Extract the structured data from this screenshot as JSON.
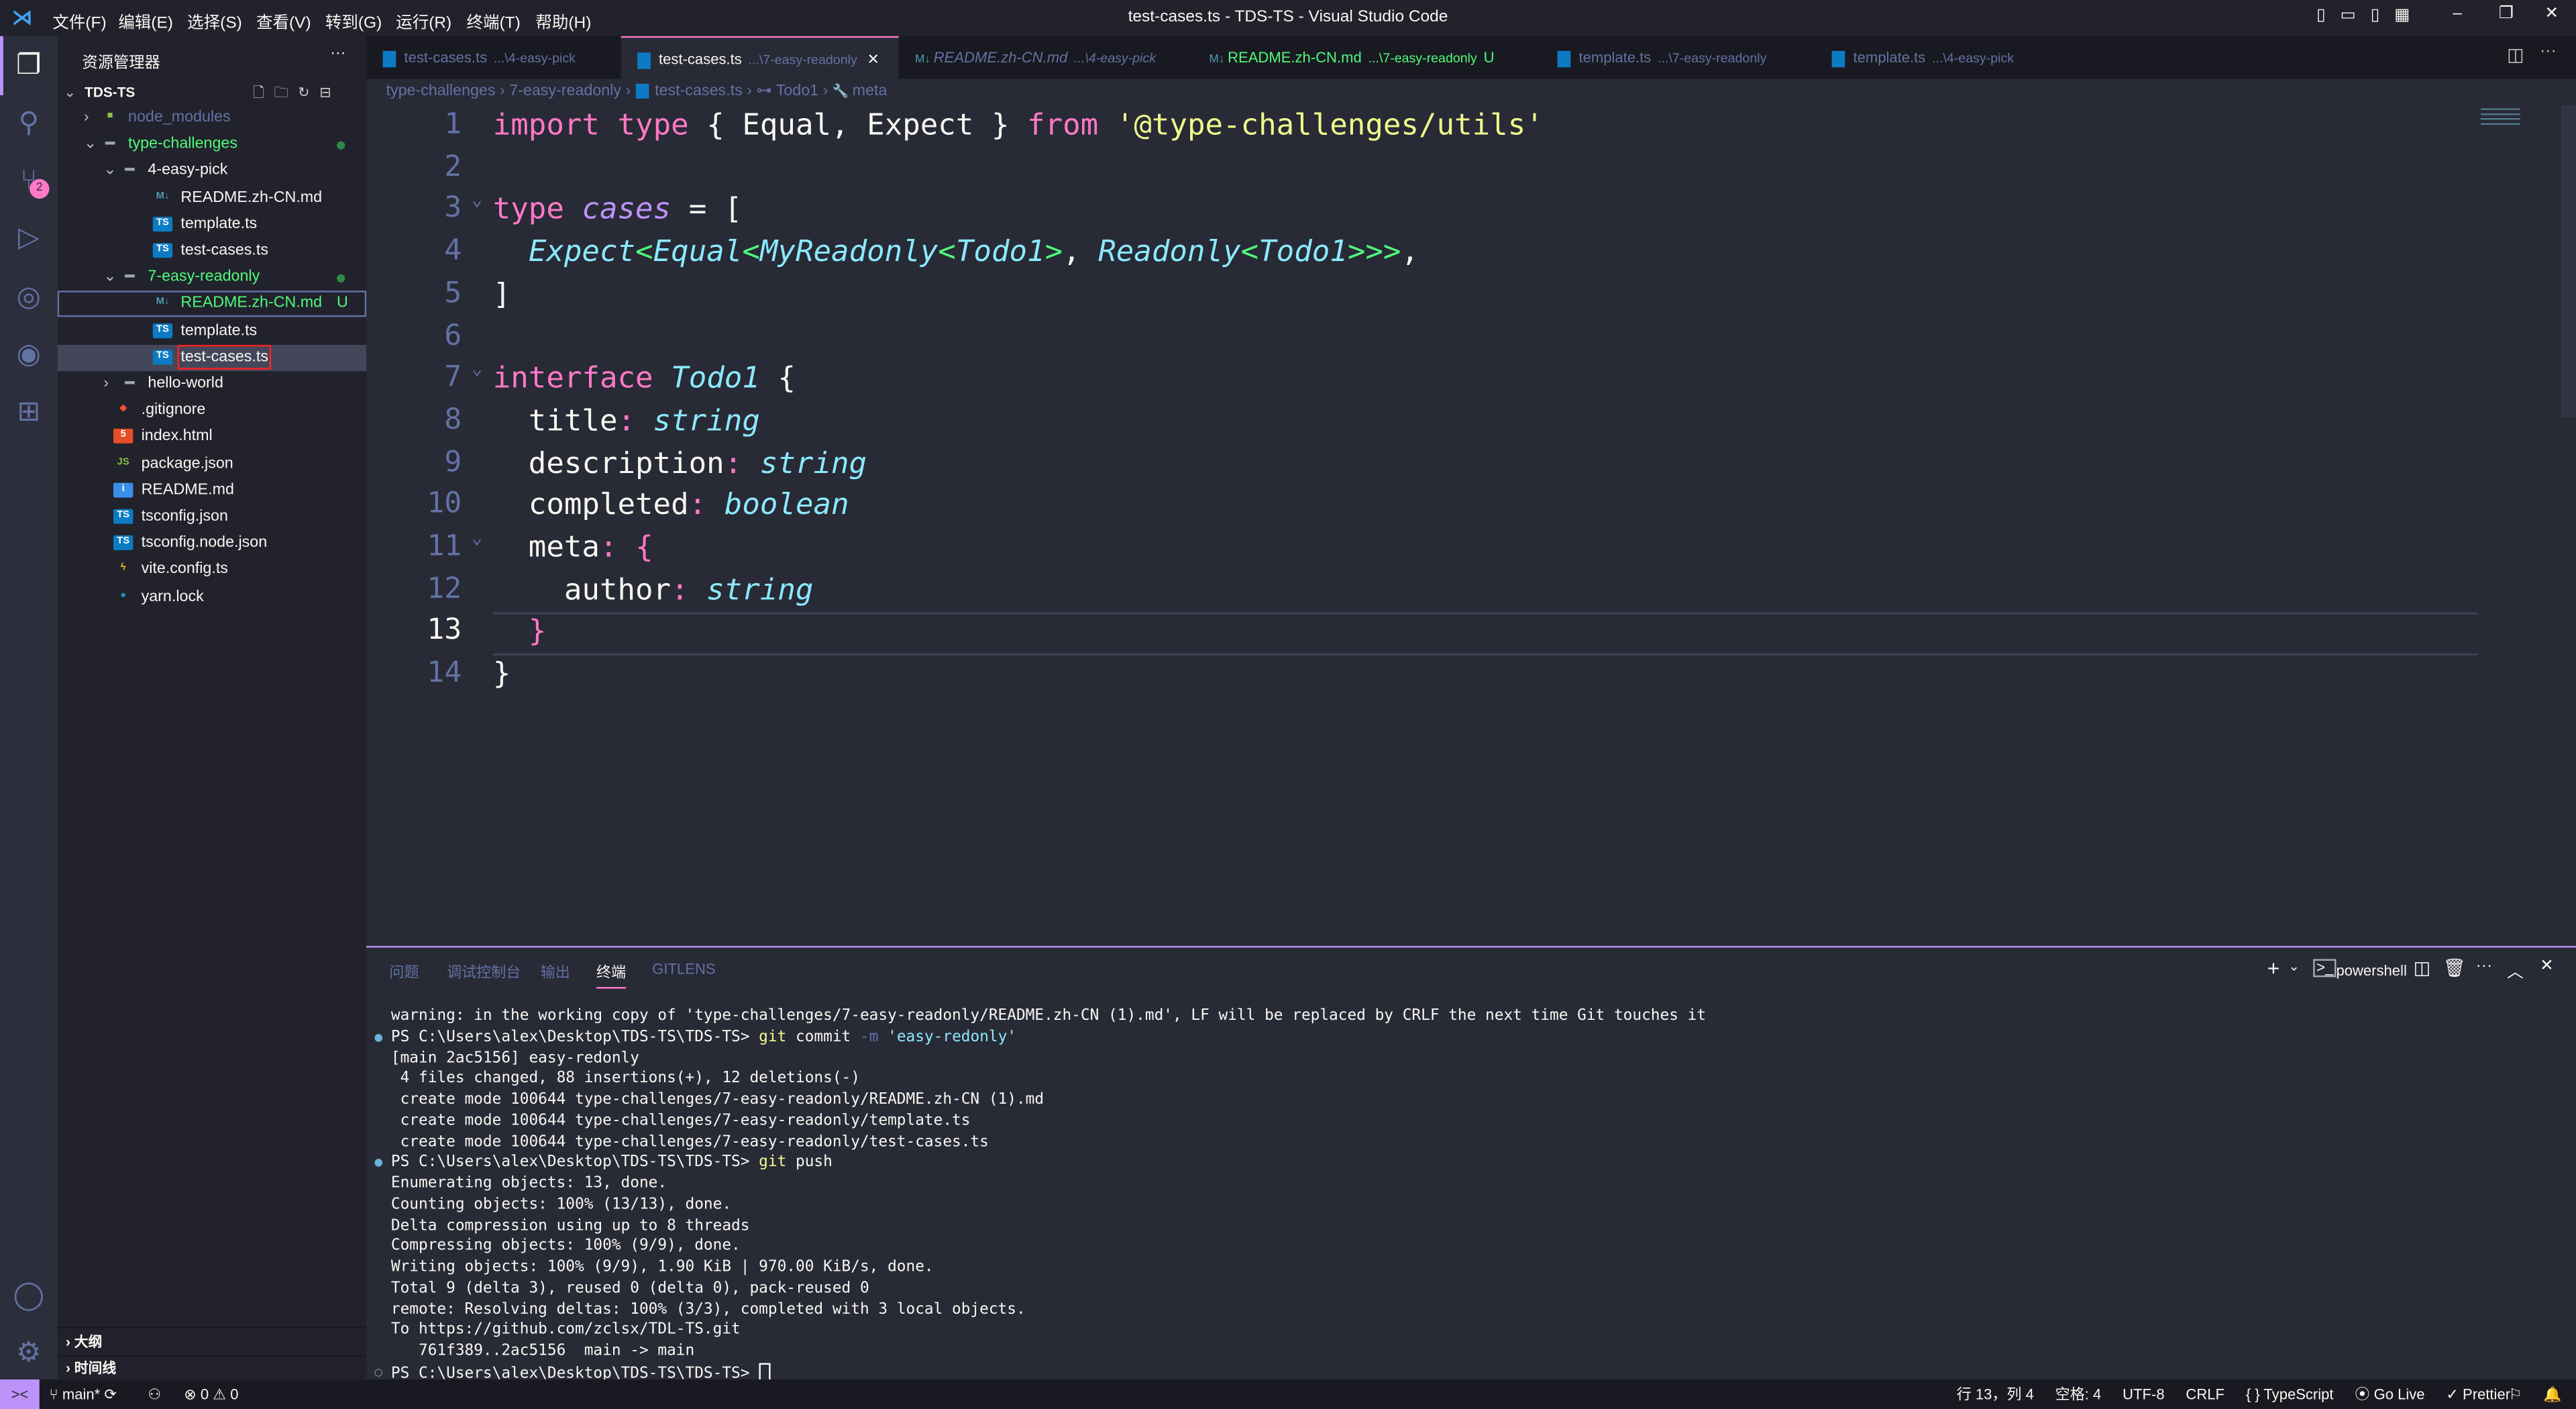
{
  "titlebar": {
    "title": "test-cases.ts - TDS-TS - Visual Studio Code",
    "menus": [
      "文件(F)",
      "编辑(E)",
      "选择(S)",
      "查看(V)",
      "转到(G)",
      "运行(R)",
      "终端(T)",
      "帮助(H)"
    ]
  },
  "activity": {
    "items": [
      "explorer-icon",
      "search-icon",
      "source-control-icon",
      "run-debug-icon",
      "remote-explorer-icon",
      "gitlens-icon",
      "extensions-icon"
    ],
    "scm_badge": "2",
    "bottom": [
      "account-icon",
      "settings-gear-icon"
    ]
  },
  "sidebar": {
    "header": "资源管理器",
    "more": "···",
    "root": "TDS-TS",
    "items": [
      {
        "label": "node_modules",
        "depth": 1,
        "kind": "folder-closed",
        "color": "#6272a4",
        "icon": "node-folder"
      },
      {
        "label": "type-challenges",
        "depth": 1,
        "kind": "folder-open",
        "color": "#50fa7b",
        "icon": "folder",
        "dot": true
      },
      {
        "label": "4-easy-pick",
        "depth": 2,
        "kind": "folder-open",
        "color": "#f8f8f2",
        "icon": "folder"
      },
      {
        "label": "README.zh-CN.md",
        "depth": 3,
        "kind": "file",
        "color": "#f8f8f2",
        "icon": "markdown"
      },
      {
        "label": "template.ts",
        "depth": 3,
        "kind": "file",
        "color": "#f8f8f2",
        "icon": "ts"
      },
      {
        "label": "test-cases.ts",
        "depth": 3,
        "kind": "file",
        "color": "#f8f8f2",
        "icon": "ts"
      },
      {
        "label": "7-easy-readonly",
        "depth": 2,
        "kind": "folder-open",
        "color": "#50fa7b",
        "icon": "folder",
        "dot": true
      },
      {
        "label": "README.zh-CN.md",
        "depth": 3,
        "kind": "file",
        "color": "#50fa7b",
        "icon": "markdown",
        "badge": "U",
        "focused": true
      },
      {
        "label": "template.ts",
        "depth": 3,
        "kind": "file",
        "color": "#f8f8f2",
        "icon": "ts"
      },
      {
        "label": "test-cases.ts",
        "depth": 3,
        "kind": "file",
        "color": "#f8f8f2",
        "icon": "ts",
        "selected": true
      },
      {
        "label": "hello-world",
        "depth": 2,
        "kind": "folder-closed",
        "color": "#f8f8f2",
        "icon": "folder"
      },
      {
        "label": ".gitignore",
        "depth": 1,
        "kind": "file",
        "color": "#f8f8f2",
        "icon": "git"
      },
      {
        "label": "index.html",
        "depth": 1,
        "kind": "file",
        "color": "#f8f8f2",
        "icon": "html"
      },
      {
        "label": "package.json",
        "depth": 1,
        "kind": "file",
        "color": "#f8f8f2",
        "icon": "nodejs"
      },
      {
        "label": "README.md",
        "depth": 1,
        "kind": "file",
        "color": "#f8f8f2",
        "icon": "info"
      },
      {
        "label": "tsconfig.json",
        "depth": 1,
        "kind": "file",
        "color": "#f8f8f2",
        "icon": "tsconfig"
      },
      {
        "label": "tsconfig.node.json",
        "depth": 1,
        "kind": "file",
        "color": "#f8f8f2",
        "icon": "tsconfig"
      },
      {
        "label": "vite.config.ts",
        "depth": 1,
        "kind": "file",
        "color": "#f8f8f2",
        "icon": "vite"
      },
      {
        "label": "yarn.lock",
        "depth": 1,
        "kind": "file",
        "color": "#f8f8f2",
        "icon": "yarn"
      }
    ],
    "outline": "大纲",
    "timeline": "时间线"
  },
  "tabs": [
    {
      "name": "test-cases.ts",
      "path": "...\\4-easy-pick",
      "icon": "ts"
    },
    {
      "name": "test-cases.ts",
      "path": "...\\7-easy-readonly",
      "icon": "ts",
      "active": true
    },
    {
      "name": "README.zh-CN.md",
      "path": "...\\4-easy-pick",
      "icon": "markdown",
      "italic": true
    },
    {
      "name": "README.zh-CN.md",
      "path": "...\\7-easy-readonly",
      "icon": "markdown",
      "status": "U",
      "green": true
    },
    {
      "name": "template.ts",
      "path": "...\\7-easy-readonly",
      "icon": "ts"
    },
    {
      "name": "template.ts",
      "path": "...\\4-easy-pick",
      "icon": "ts"
    }
  ],
  "breadcrumb": [
    "type-challenges",
    "7-easy-readonly",
    "test-cases.ts",
    "Todo1",
    "meta"
  ],
  "editor": {
    "current_line": 13,
    "lines": [
      [
        [
          "import",
          "k"
        ],
        [
          " type ",
          "k"
        ],
        [
          "{ ",
          "p"
        ],
        [
          "Equal",
          "p"
        ],
        [
          ", ",
          "p"
        ],
        [
          "Expect",
          "p"
        ],
        [
          " } ",
          "p"
        ],
        [
          "from",
          "k"
        ],
        [
          " ",
          "p"
        ],
        [
          "'@type-challenges/utils'",
          "s"
        ]
      ],
      [],
      [
        [
          "type",
          "k"
        ],
        [
          " ",
          "p"
        ],
        [
          "cases",
          "pu"
        ],
        [
          " = [",
          "p"
        ]
      ],
      [
        [
          "  ",
          "p"
        ],
        [
          "Expect",
          "t"
        ],
        [
          "<",
          "g"
        ],
        [
          "Equal",
          "t"
        ],
        [
          "<",
          "g"
        ],
        [
          "MyReadonly",
          "t"
        ],
        [
          "<",
          "g"
        ],
        [
          "Todo1",
          "t"
        ],
        [
          ">",
          "g"
        ],
        [
          ", ",
          "p"
        ],
        [
          "Readonly",
          "t"
        ],
        [
          "<",
          "g"
        ],
        [
          "Todo1",
          "t"
        ],
        [
          ">>>",
          "g"
        ],
        [
          ",",
          "p"
        ]
      ],
      [
        [
          "]",
          "p"
        ]
      ],
      [],
      [
        [
          "interface",
          "k"
        ],
        [
          " ",
          "p"
        ],
        [
          "Todo1",
          "t"
        ],
        [
          " {",
          "p"
        ]
      ],
      [
        [
          "  title",
          "p"
        ],
        [
          ": ",
          "k"
        ],
        [
          "string",
          "t"
        ]
      ],
      [
        [
          "  description",
          "p"
        ],
        [
          ": ",
          "k"
        ],
        [
          "string",
          "t"
        ]
      ],
      [
        [
          "  completed",
          "p"
        ],
        [
          ": ",
          "k"
        ],
        [
          "boolean",
          "t"
        ]
      ],
      [
        [
          "  meta",
          "p"
        ],
        [
          ": ",
          "k"
        ],
        [
          "{",
          "k"
        ]
      ],
      [
        [
          "    author",
          "p"
        ],
        [
          ": ",
          "k"
        ],
        [
          "string",
          "t"
        ]
      ],
      [
        [
          "  }",
          "k"
        ]
      ],
      [
        [
          "}",
          "p"
        ]
      ]
    ]
  },
  "panel": {
    "tabs": [
      "问题",
      "调试控制台",
      "输出",
      "终端",
      "GITLENS"
    ],
    "active_tab": "终端",
    "shell": "powershell",
    "terminal": [
      {
        "segs": [
          [
            "warning: in the working copy of 'type-challenges/7-easy-readonly/README.zh-CN (1).md', LF will be replaced by CRLF the next time Git touches it",
            "#f8f8f2"
          ]
        ]
      },
      {
        "dot": "filled",
        "segs": [
          [
            "PS C:\\Users\\alex\\Desktop\\TDS-TS\\TDS-TS> ",
            "#f8f8f2"
          ],
          [
            "git",
            "#f1fa8c"
          ],
          [
            " commit ",
            "#f8f8f2"
          ],
          [
            "-m",
            "#6272a4"
          ],
          [
            " 'easy-redonly'",
            "#8be9fd"
          ]
        ]
      },
      {
        "segs": [
          [
            "[main 2ac5156] easy-redonly",
            "#f8f8f2"
          ]
        ]
      },
      {
        "segs": [
          [
            " 4 files changed, 88 insertions(+), 12 deletions(-)",
            "#f8f8f2"
          ]
        ]
      },
      {
        "segs": [
          [
            " create mode 100644 type-challenges/7-easy-readonly/README.zh-CN (1).md",
            "#f8f8f2"
          ]
        ]
      },
      {
        "segs": [
          [
            " create mode 100644 type-challenges/7-easy-readonly/template.ts",
            "#f8f8f2"
          ]
        ]
      },
      {
        "segs": [
          [
            " create mode 100644 type-challenges/7-easy-readonly/test-cases.ts",
            "#f8f8f2"
          ]
        ]
      },
      {
        "dot": "filled",
        "segs": [
          [
            "PS C:\\Users\\alex\\Desktop\\TDS-TS\\TDS-TS> ",
            "#f8f8f2"
          ],
          [
            "git",
            "#f1fa8c"
          ],
          [
            " push",
            "#f8f8f2"
          ]
        ]
      },
      {
        "segs": [
          [
            "Enumerating objects: 13, done.",
            "#f8f8f2"
          ]
        ]
      },
      {
        "segs": [
          [
            "Counting objects: 100% (13/13), done.",
            "#f8f8f2"
          ]
        ]
      },
      {
        "segs": [
          [
            "Delta compression using up to 8 threads",
            "#f8f8f2"
          ]
        ]
      },
      {
        "segs": [
          [
            "Compressing objects: 100% (9/9), done.",
            "#f8f8f2"
          ]
        ]
      },
      {
        "segs": [
          [
            "Writing objects: 100% (9/9), 1.90 KiB | 970.00 KiB/s, done.",
            "#f8f8f2"
          ]
        ]
      },
      {
        "segs": [
          [
            "Total 9 (delta 3), reused 0 (delta 0), pack-reused 0",
            "#f8f8f2"
          ]
        ]
      },
      {
        "segs": [
          [
            "remote: Resolving deltas: 100% (3/3), completed with 3 local objects.",
            "#f8f8f2"
          ]
        ]
      },
      {
        "segs": [
          [
            "To https://github.com/zclsx/TDL-TS.git",
            "#f8f8f2"
          ]
        ]
      },
      {
        "segs": [
          [
            "   761f389..2ac5156  main -> main",
            "#f8f8f2"
          ]
        ]
      },
      {
        "dot": "empty",
        "segs": [
          [
            "PS C:\\Users\\alex\\Desktop\\TDS-TS\\TDS-TS> ",
            "#f8f8f2"
          ]
        ],
        "cursor": true
      }
    ]
  },
  "status": {
    "remote": "><",
    "branch": "main*",
    "sync": "⟳",
    "errors": "0",
    "warnings": "0",
    "right": [
      "行 13，列 4",
      "空格: 4",
      "UTF-8",
      "CRLF",
      "{ } TypeScript",
      "⦿ Go Live",
      "✓ Prettier"
    ]
  },
  "colors": {
    "accent": "#bd93f9",
    "keyword": "#ff79c6",
    "type": "#8be9fd",
    "string": "#f1fa8c",
    "git_added": "#50fa7b",
    "comment": "#6272a4"
  }
}
